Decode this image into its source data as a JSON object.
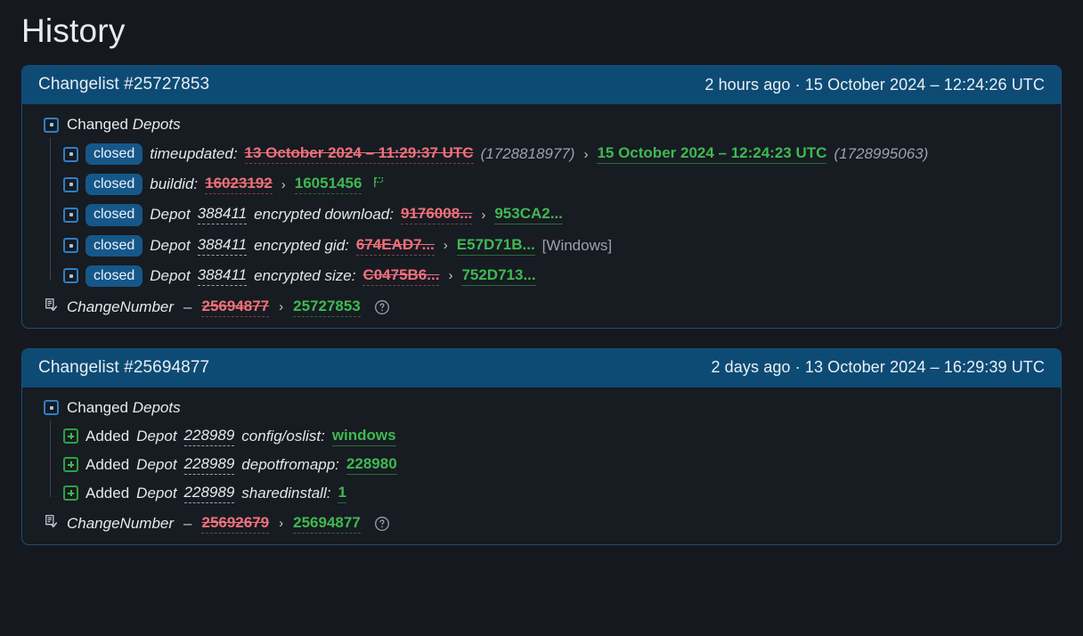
{
  "page": {
    "title": "History"
  },
  "changelists": [
    {
      "header": {
        "title": "Changelist #25727853",
        "time": "2 hours ago · 15 October 2024 – 12:24:26 UTC"
      },
      "group": {
        "prefix": "Changed ",
        "name": "Depots",
        "icon": "dot-square-icon"
      },
      "rows": [
        {
          "icon": "dot-square-icon",
          "badge": "closed",
          "label": "timeupdated:",
          "old": "13 October 2024 – 11:29:37 UTC",
          "old_epoch": "(1728818977)",
          "arrow": "›",
          "new": "15 October 2024 – 12:24:23 UTC",
          "new_epoch": "(1728995063)",
          "platform": "",
          "flag": false
        },
        {
          "icon": "dot-square-icon",
          "badge": "closed",
          "label": "buildid:",
          "old": "16023192",
          "old_epoch": "",
          "arrow": "›",
          "new": "16051456",
          "new_epoch": "",
          "platform": "",
          "flag": true
        },
        {
          "icon": "dot-square-icon",
          "badge": "closed",
          "label_pre": "Depot ",
          "depot": "388411",
          "label": "encrypted download:",
          "old": "9176008...",
          "old_epoch": "",
          "arrow": "›",
          "new": "953CA2...",
          "new_epoch": "",
          "platform": "",
          "flag": false
        },
        {
          "icon": "dot-square-icon",
          "badge": "closed",
          "label_pre": "Depot ",
          "depot": "388411",
          "label": "encrypted gid:",
          "old": "674EAD7...",
          "old_epoch": "",
          "arrow": "›",
          "new": "E57D71B...",
          "new_epoch": "",
          "platform": "[Windows]",
          "flag": false
        },
        {
          "icon": "dot-square-icon",
          "badge": "closed",
          "label_pre": "Depot ",
          "depot": "388411",
          "label": "encrypted size:",
          "old": "C0475B6...",
          "old_epoch": "",
          "arrow": "›",
          "new": "752D713...",
          "new_epoch": "",
          "platform": "",
          "flag": false
        }
      ],
      "footer": {
        "icon": "document-check-icon",
        "label": "ChangeNumber",
        "dash": "–",
        "old": "25694877",
        "arrow": "›",
        "new": "25727853",
        "help_icon": "help-circle-icon"
      }
    },
    {
      "header": {
        "title": "Changelist #25694877",
        "time": "2 days ago · 13 October 2024 – 16:29:39 UTC"
      },
      "group": {
        "prefix": "Changed ",
        "name": "Depots",
        "icon": "dot-square-icon"
      },
      "rows": [
        {
          "icon": "plus-square-icon",
          "badge": "",
          "action": "Added ",
          "label_pre": "Depot ",
          "depot": "228989",
          "label": "config/oslist:",
          "old": "",
          "arrow": "",
          "new": "windows",
          "platform": "",
          "flag": false
        },
        {
          "icon": "plus-square-icon",
          "badge": "",
          "action": "Added ",
          "label_pre": "Depot ",
          "depot": "228989",
          "label": "depotfromapp:",
          "old": "",
          "arrow": "",
          "new": "228980",
          "platform": "",
          "flag": false
        },
        {
          "icon": "plus-square-icon",
          "badge": "",
          "action": "Added ",
          "label_pre": "Depot ",
          "depot": "228989",
          "label": "sharedinstall:",
          "old": "",
          "arrow": "",
          "new": "1",
          "platform": "",
          "flag": false
        }
      ],
      "footer": {
        "icon": "document-check-icon",
        "label": "ChangeNumber",
        "dash": "–",
        "old": "25692679",
        "arrow": "›",
        "new": "25694877",
        "help_icon": "help-circle-icon"
      }
    }
  ],
  "colors": {
    "background": "#15191f",
    "header_blue": "#0d4b75",
    "card_border": "#1b4f7a",
    "badge_blue": "#16578a",
    "added_green": "#3fb950",
    "removed_red": "#f1707a",
    "muted": "#9aa2ab"
  }
}
